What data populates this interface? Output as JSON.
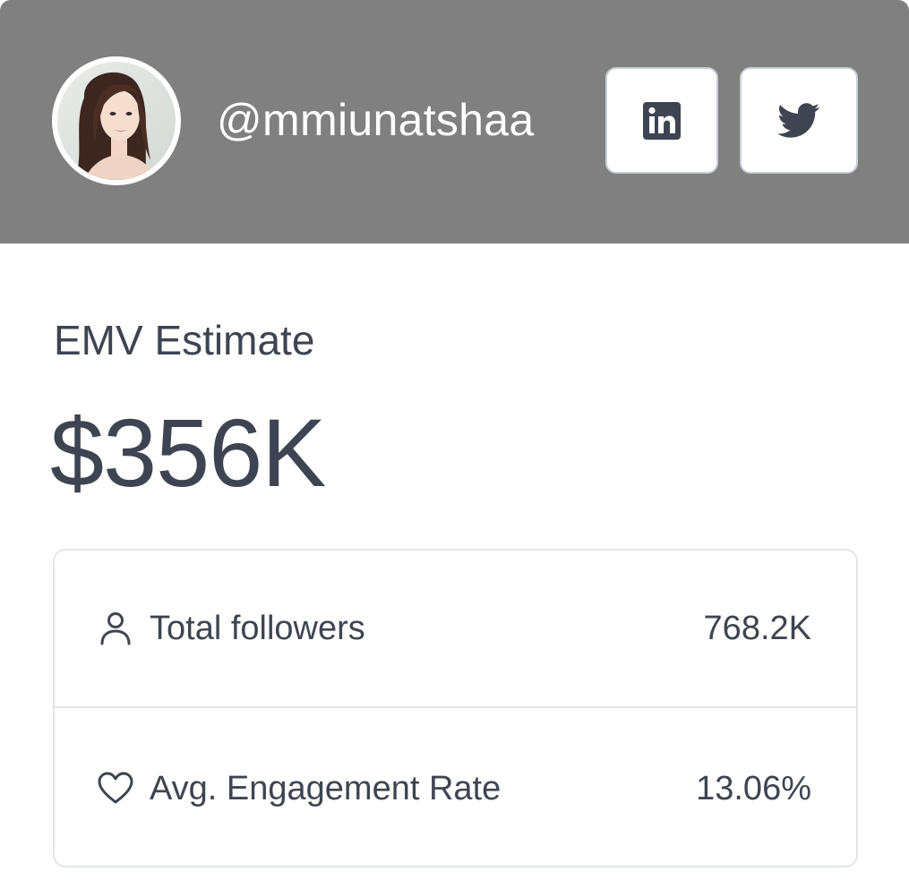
{
  "header": {
    "background_color": "#808080",
    "avatar_icon": "profile-photo",
    "handle": "@mmiunatshaa",
    "social_buttons": [
      {
        "icon": "linkedin-icon"
      },
      {
        "icon": "twitter-icon"
      }
    ]
  },
  "emv": {
    "label": "EMV Estimate",
    "value": "$356K"
  },
  "stats": [
    {
      "icon": "user-icon",
      "label": "Total followers",
      "value": "768.2K"
    },
    {
      "icon": "heart-icon",
      "label": "Avg. Engagement Rate",
      "value": "13.06%"
    }
  ],
  "colors": {
    "text": "#3f4452",
    "header_bg": "#808080",
    "border": "#e3e5ea"
  }
}
